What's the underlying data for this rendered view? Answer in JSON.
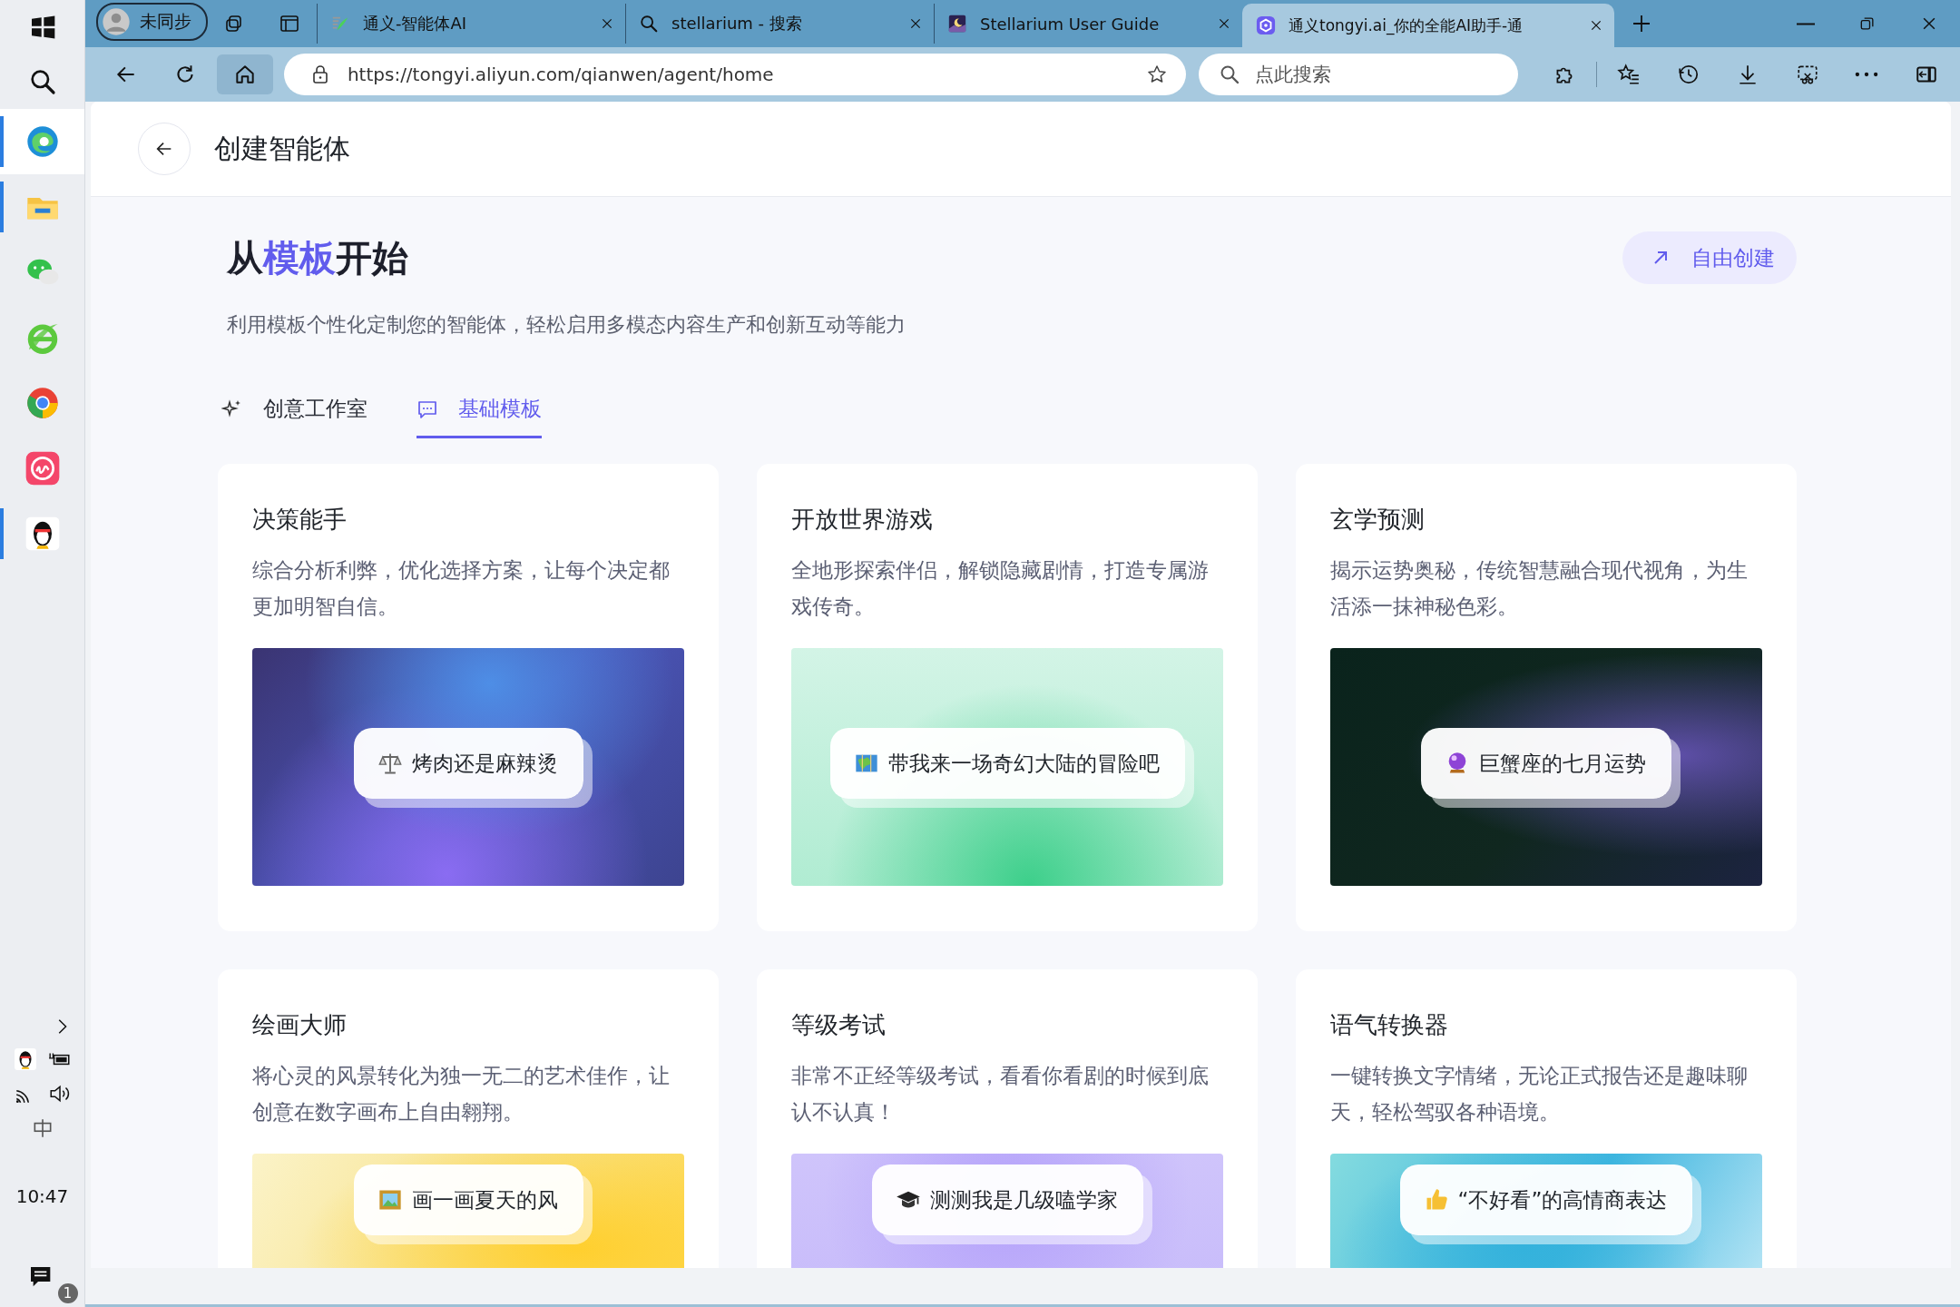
{
  "taskbar": {
    "apps": [
      {
        "selected": true,
        "running": true
      },
      {
        "selected": false,
        "running": true
      },
      {
        "selected": false,
        "running": false
      },
      {
        "selected": false,
        "running": false
      },
      {
        "selected": false,
        "running": false
      },
      {
        "selected": false,
        "running": false
      },
      {
        "selected": false,
        "running": true
      }
    ],
    "time": "10:47",
    "notifications": "1"
  },
  "browser": {
    "profile": "未同步",
    "tabs": [
      {
        "title": "通义-智能体AI",
        "selected": false
      },
      {
        "title": "stellarium - 搜索",
        "selected": false
      },
      {
        "title": "Stellarium User Guide",
        "selected": false
      },
      {
        "title": "通义tongyi.ai_你的全能AI助手-通",
        "selected": true
      }
    ],
    "address": "https://tongyi.aliyun.com/qianwen/agent/home",
    "search": {
      "placeholder": "点此搜索"
    }
  },
  "page": {
    "title": "创建智能体",
    "heading": {
      "before": "从",
      "highlight": "模板",
      "after": "开始"
    },
    "free_create": "自由创建",
    "subtitle": "利用模板个性化定制您的智能体，轻松启用多模态内容生产和创新互动等能力",
    "tabs": [
      {
        "label": "创意工作室",
        "selected": false
      },
      {
        "label": "基础模板",
        "selected": true
      }
    ],
    "cards": [
      {
        "title": "决策能手",
        "description": "综合分析利弊，优化选择方案，让每个决定都更加明智自信。",
        "prompt": "烤肉还是麻辣烫"
      },
      {
        "title": "开放世界游戏",
        "description": "全地形探索伴侣，解锁隐藏剧情，打造专属游戏传奇。",
        "prompt": "带我来一场奇幻大陆的冒险吧"
      },
      {
        "title": "玄学预测",
        "description": "揭示运势奥秘，传统智慧融合现代视角，为生活添一抹神秘色彩。",
        "prompt": "巨蟹座的七月运势"
      },
      {
        "title": "绘画大师",
        "description": "将心灵的风景转化为独一无二的艺术佳作，让创意在数字画布上自由翱翔。",
        "prompt": "画一画夏天的风"
      },
      {
        "title": "等级考试",
        "description": "非常不正经等级考试，看看你看剧的时候到底认不认真！",
        "prompt": "测测我是几级嗑学家"
      },
      {
        "title": "语气转换器",
        "description": "一键转换文字情绪，无论正式报告还是趣味聊天，轻松驾驭各种语境。",
        "prompt": "“不好看”的高情商表达"
      }
    ]
  }
}
